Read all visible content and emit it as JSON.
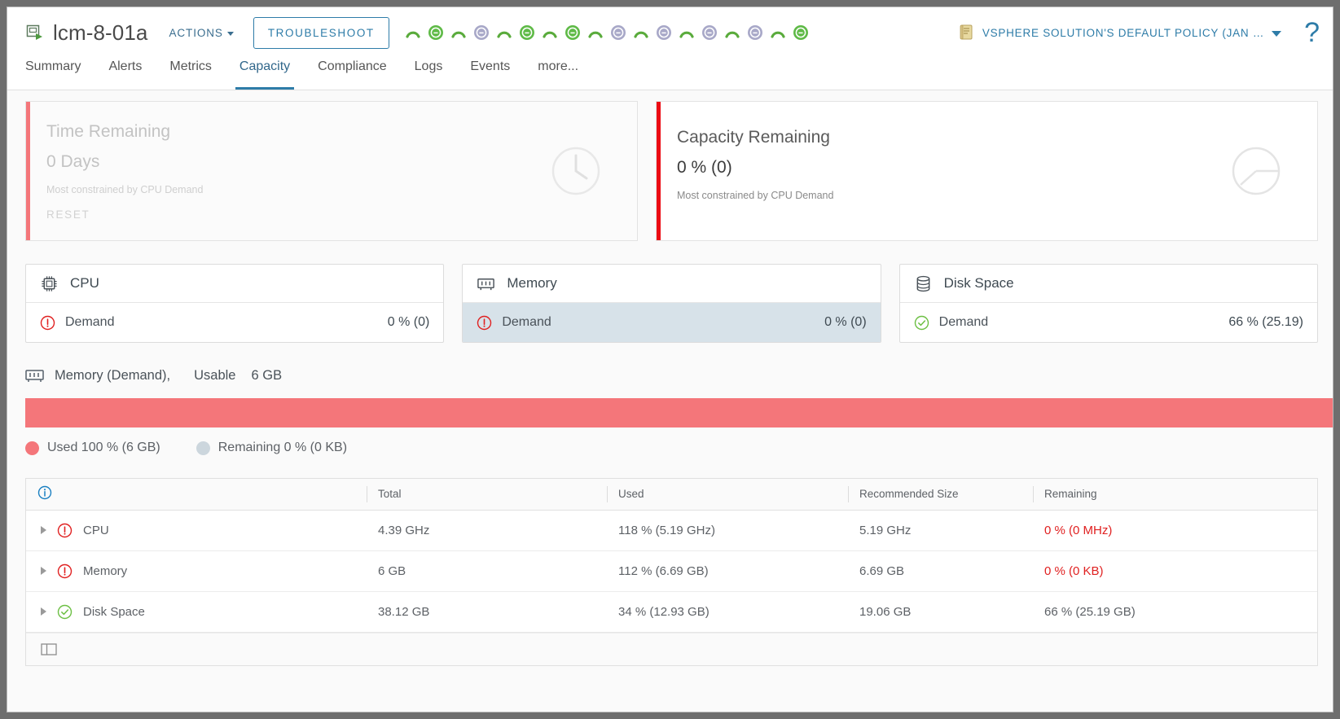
{
  "header": {
    "object_icon": "virtual-machine-icon",
    "title": "lcm-8-01a",
    "actions_label": "ACTIONS",
    "troubleshoot_label": "TROUBLESHOOT",
    "policy_icon": "policy-scroll-icon",
    "policy_label": "VSPHERE SOLUTION'S DEFAULT POLICY (JAN …",
    "help_label": "?",
    "badge_strip": [
      {
        "type": "arc",
        "color": "#5aab3c"
      },
      {
        "type": "circle",
        "color": "#5fba47"
      },
      {
        "type": "arc",
        "color": "#5aab3c"
      },
      {
        "type": "circle",
        "color": "#a8a8c8"
      },
      {
        "type": "arc",
        "color": "#5aab3c"
      },
      {
        "type": "circle",
        "color": "#5fba47"
      },
      {
        "type": "arc",
        "color": "#5aab3c"
      },
      {
        "type": "circle",
        "color": "#5fba47"
      },
      {
        "type": "arc",
        "color": "#5aab3c"
      },
      {
        "type": "circle",
        "color": "#a8a8c8"
      },
      {
        "type": "arc",
        "color": "#5aab3c"
      },
      {
        "type": "circle",
        "color": "#a8a8c8"
      },
      {
        "type": "arc",
        "color": "#5aab3c"
      },
      {
        "type": "circle",
        "color": "#a8a8c8"
      },
      {
        "type": "arc",
        "color": "#5aab3c"
      },
      {
        "type": "circle",
        "color": "#a8a8c8"
      },
      {
        "type": "arc",
        "color": "#5aab3c"
      },
      {
        "type": "circle",
        "color": "#5fba47"
      }
    ]
  },
  "tabs": [
    {
      "label": "Summary",
      "active": false
    },
    {
      "label": "Alerts",
      "active": false
    },
    {
      "label": "Metrics",
      "active": false
    },
    {
      "label": "Capacity",
      "active": true
    },
    {
      "label": "Compliance",
      "active": false
    },
    {
      "label": "Logs",
      "active": false
    },
    {
      "label": "Events",
      "active": false
    },
    {
      "label": "more...",
      "active": false
    }
  ],
  "summary_cards": [
    {
      "id": "time-remaining",
      "title": "Time Remaining",
      "value": "0 Days",
      "subtitle": "Most constrained by CPU Demand",
      "action_label": "RESET",
      "bar_color": "#f4767a",
      "glyph": "clock-icon",
      "disabled": true
    },
    {
      "id": "capacity-remaining",
      "title": "Capacity Remaining",
      "value": "0 % (0)",
      "subtitle": "Most constrained by CPU Demand",
      "bar_color": "#ec0c13",
      "glyph": "pie-chart-icon",
      "disabled": false
    }
  ],
  "resource_cards": [
    {
      "id": "cpu",
      "icon": "cpu-chip-icon",
      "title": "CPU",
      "status": "critical",
      "metric_label": "Demand",
      "metric_value": "0 % (0)",
      "selected": false
    },
    {
      "id": "memory",
      "icon": "memory-module-icon",
      "title": "Memory",
      "status": "critical",
      "metric_label": "Demand",
      "metric_value": "0 % (0)",
      "selected": true
    },
    {
      "id": "disk-space",
      "icon": "database-disk-icon",
      "title": "Disk Space",
      "status": "ok",
      "metric_label": "Demand",
      "metric_value": "66 % (25.19)",
      "selected": false
    }
  ],
  "chart_data": {
    "type": "bar",
    "title": "Memory (Demand),",
    "usable_label": "Usable",
    "usable_value": "6 GB",
    "icon": "memory-module-icon",
    "orientation": "horizontal-stacked",
    "categories": [
      "Used",
      "Remaining"
    ],
    "values": [
      100,
      0
    ],
    "value_labels": [
      "Used 100 % (6 GB)",
      "Remaining 0 % (0 KB)"
    ],
    "colors": [
      "#f4767a",
      "#ccd6dd"
    ],
    "legend": [
      {
        "label": "Used 100 % (6 GB)",
        "color": "#f4767a",
        "percent": 100,
        "absolute": "6 GB"
      },
      {
        "label": "Remaining 0 % (0 KB)",
        "color": "#ccd6dd",
        "percent": 0,
        "absolute": "0 KB"
      }
    ],
    "legend_position": "bottom-left",
    "grid": false,
    "xlabel": "",
    "ylabel": "",
    "xlim": [
      0,
      100
    ]
  },
  "table": {
    "info_icon": "info-icon",
    "columns": [
      "",
      "Total",
      "Used",
      "Recommended Size",
      "Remaining"
    ],
    "rows": [
      {
        "status": "critical",
        "name": "CPU",
        "total": "4.39 GHz",
        "used": "118 % (5.19 GHz)",
        "recommended": "5.19 GHz",
        "remaining": "0 % (0 MHz)",
        "remaining_alert": true
      },
      {
        "status": "critical",
        "name": "Memory",
        "total": "6 GB",
        "used": "112 % (6.69 GB)",
        "recommended": "6.69 GB",
        "remaining": "0 % (0 KB)",
        "remaining_alert": true
      },
      {
        "status": "ok",
        "name": "Disk Space",
        "total": "38.12 GB",
        "used": "34 % (12.93 GB)",
        "recommended": "19.06 GB",
        "remaining": "66 % (25.19 GB)",
        "remaining_alert": false
      }
    ],
    "footer_icon": "panel-toggle-icon"
  },
  "colors": {
    "accent": "#2e7ca8",
    "critical": "#e02020",
    "ok_green": "#6cbf43",
    "salmon": "#f4767a",
    "red_bar": "#ec0c13",
    "selected_row": "#d7e2e9"
  }
}
